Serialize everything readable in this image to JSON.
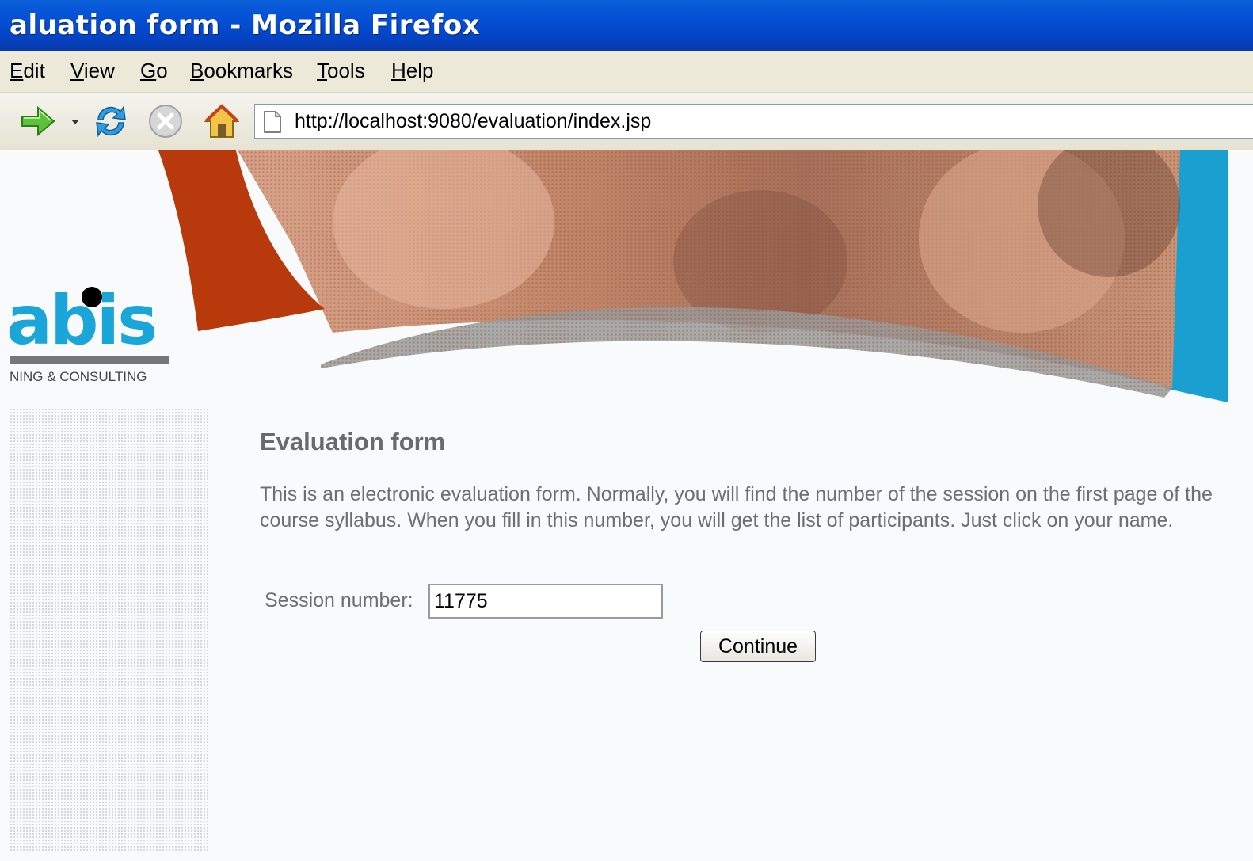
{
  "window": {
    "title": "aluation form - Mozilla Firefox"
  },
  "menubar": {
    "items": [
      {
        "underline": "E",
        "rest": "dit"
      },
      {
        "underline": "V",
        "rest": "iew"
      },
      {
        "underline": "G",
        "rest": "o"
      },
      {
        "underline": "B",
        "rest": "ookmarks"
      },
      {
        "underline": "T",
        "rest": "ools"
      },
      {
        "underline": "H",
        "rest": "elp"
      }
    ]
  },
  "toolbar": {
    "address": "http://localhost:9080/evaluation/index.jsp",
    "icons": [
      "forward-icon",
      "dropdown-arrow-icon",
      "reload-icon",
      "stop-icon",
      "home-icon",
      "page-icon"
    ]
  },
  "logo": {
    "text": "abis",
    "subtitle": "NING & CONSULTING"
  },
  "main": {
    "heading": "Evaluation form",
    "intro": "This is an electronic evaluation form. Normally, you will find the number of the session on the first page of the course syllabus. When you fill in this number, you will get the list of participants. Just click on your name.",
    "session_label": "Session number:",
    "session_value": "11775",
    "continue_label": "Continue"
  },
  "colors": {
    "titlebar": "#0551d6",
    "logo": "#1aa6d8",
    "banner_orange": "#b83a0c",
    "banner_blue": "#1aa0d0",
    "banner_photo": "#c48a6e"
  }
}
